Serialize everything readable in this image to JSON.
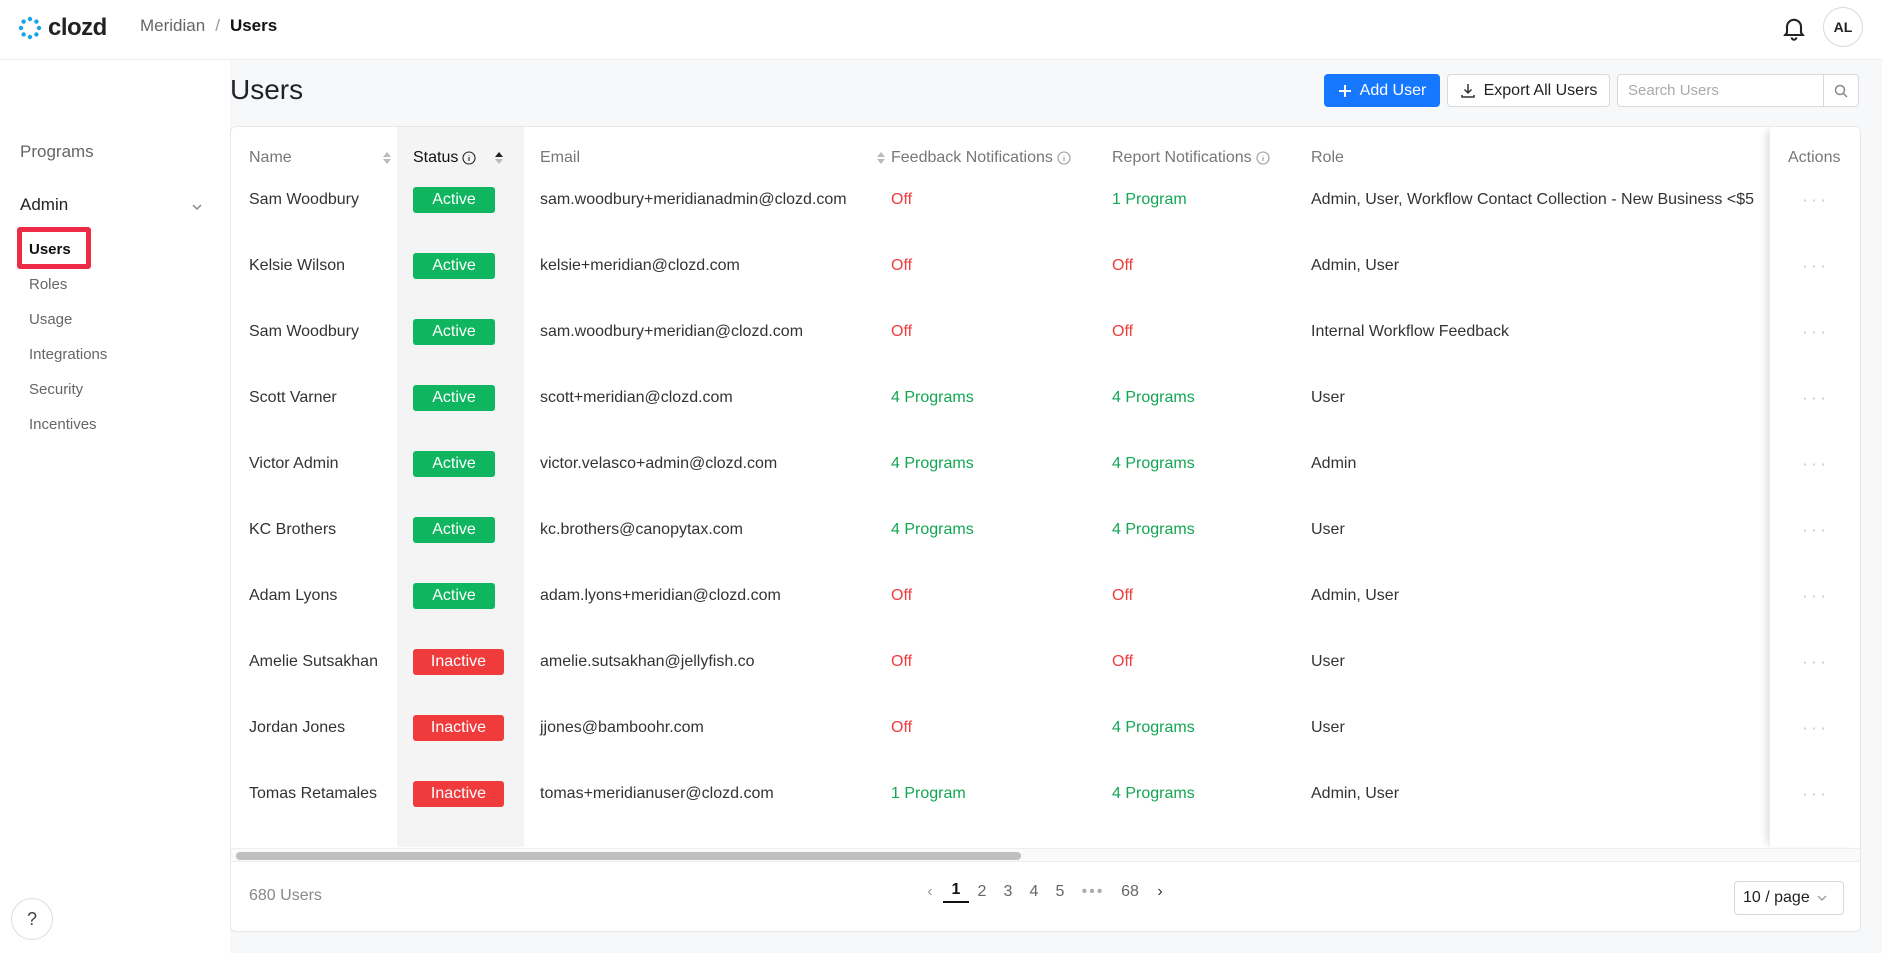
{
  "app": {
    "brand": "clozd",
    "breadcrumb": {
      "parent": "Meridian",
      "separator": "/",
      "current": "Users"
    },
    "avatar_initials": "AL"
  },
  "sidebar": {
    "programs_label": "Programs",
    "admin_label": "Admin",
    "items": [
      {
        "label": "Users",
        "active": true
      },
      {
        "label": "Roles",
        "active": false
      },
      {
        "label": "Usage",
        "active": false
      },
      {
        "label": "Integrations",
        "active": false
      },
      {
        "label": "Security",
        "active": false
      },
      {
        "label": "Incentives",
        "active": false
      }
    ],
    "help_label": "?"
  },
  "page": {
    "title": "Users",
    "add_user_label": "Add User",
    "export_label": "Export All Users",
    "search_placeholder": "Search Users"
  },
  "table": {
    "columns": {
      "name": "Name",
      "status": "Status",
      "email": "Email",
      "feedback": "Feedback Notifications",
      "report": "Report Notifications",
      "role": "Role",
      "actions": "Actions"
    },
    "rows": [
      {
        "name": "Sam Woodbury",
        "status": "Active",
        "email": "sam.woodbury+meridianadmin@clozd.com",
        "feedback": "Off",
        "report": "1 Program",
        "role": "Admin, User, Workflow Contact Collection - New Business <$5"
      },
      {
        "name": "Kelsie Wilson",
        "status": "Active",
        "email": "kelsie+meridian@clozd.com",
        "feedback": "Off",
        "report": "Off",
        "role": "Admin, User"
      },
      {
        "name": "Sam Woodbury",
        "status": "Active",
        "email": "sam.woodbury+meridian@clozd.com",
        "feedback": "Off",
        "report": "Off",
        "role": "Internal Workflow Feedback"
      },
      {
        "name": "Scott Varner",
        "status": "Active",
        "email": "scott+meridian@clozd.com",
        "feedback": "4 Programs",
        "report": "4 Programs",
        "role": "User"
      },
      {
        "name": "Victor Admin",
        "status": "Active",
        "email": "victor.velasco+admin@clozd.com",
        "feedback": "4 Programs",
        "report": "4 Programs",
        "role": "Admin"
      },
      {
        "name": "KC Brothers",
        "status": "Active",
        "email": "kc.brothers@canopytax.com",
        "feedback": "4 Programs",
        "report": "4 Programs",
        "role": "User"
      },
      {
        "name": "Adam Lyons",
        "status": "Active",
        "email": "adam.lyons+meridian@clozd.com",
        "feedback": "Off",
        "report": "Off",
        "role": "Admin, User"
      },
      {
        "name": "Amelie Sutsakhan",
        "status": "Inactive",
        "email": "amelie.sutsakhan@jellyfish.co",
        "feedback": "Off",
        "report": "Off",
        "role": "User"
      },
      {
        "name": "Jordan Jones",
        "status": "Inactive",
        "email": "jjones@bamboohr.com",
        "feedback": "Off",
        "report": "4 Programs",
        "role": "User"
      },
      {
        "name": "Tomas Retamales",
        "status": "Inactive",
        "email": "tomas+meridianuser@clozd.com",
        "feedback": "1 Program",
        "report": "4 Programs",
        "role": "Admin, User"
      }
    ],
    "actions_glyph": "···"
  },
  "footer": {
    "total": "680 Users",
    "pages": [
      "1",
      "2",
      "3",
      "4",
      "5"
    ],
    "ellipsis": "•••",
    "last_page": "68",
    "page_size": "10 / page"
  },
  "colors": {
    "primary": "#1677ff",
    "active_badge": "#10b560",
    "inactive_badge": "#ef3b3b",
    "off_text": "#f03c3c",
    "on_text": "#12a653",
    "highlight": "#ee2b47"
  }
}
